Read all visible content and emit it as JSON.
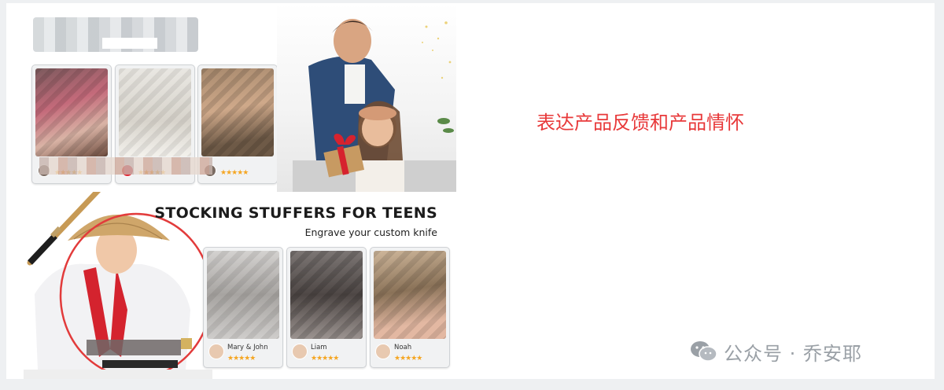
{
  "creative": {
    "top_banner": {
      "review_cards": [
        {
          "stars": "★★★★★"
        },
        {
          "stars": "★★★★★"
        },
        {
          "stars": "★★★★★"
        }
      ]
    },
    "bottom_banner": {
      "headline": "STOCKING STUFFERS FOR TEENS",
      "subline": "Engrave your custom knife",
      "review_cards": [
        {
          "name": "Mary & John",
          "stars": "★★★★★"
        },
        {
          "name": "Liam",
          "stars": "★★★★★"
        },
        {
          "name": "Noah",
          "stars": "★★★★★"
        }
      ]
    }
  },
  "annotation": {
    "text": "表达产品反馈和产品情怀",
    "color": "#e8393a"
  },
  "watermark": {
    "icon": "wechat-icon",
    "text": "公众号 · 乔安耶"
  }
}
